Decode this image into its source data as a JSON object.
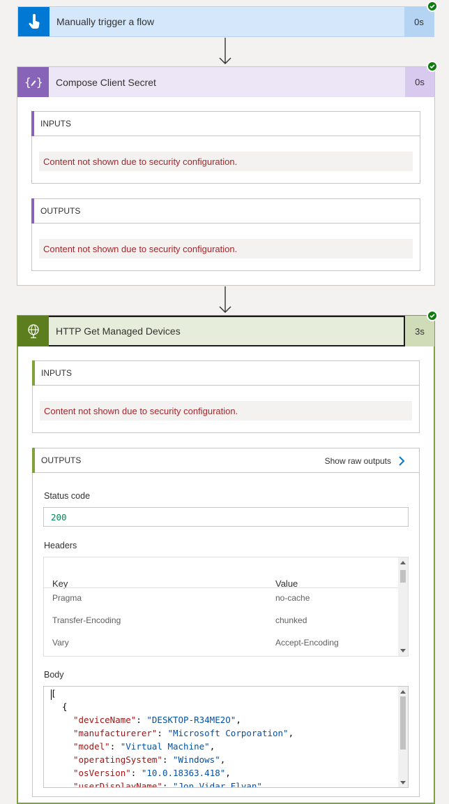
{
  "trigger": {
    "title": "Manually trigger a flow",
    "duration": "0s",
    "icon": "hand-touch-icon"
  },
  "compose": {
    "title": "Compose Client Secret",
    "duration": "0s",
    "icon": "compose-braces-icon",
    "inputs_label": "INPUTS",
    "inputs_msg": "Content not shown due to security configuration.",
    "outputs_label": "OUTPUTS",
    "outputs_msg": "Content not shown due to security configuration."
  },
  "http": {
    "title": "HTTP Get Managed Devices",
    "duration": "3s",
    "icon": "globe-icon",
    "inputs_label": "INPUTS",
    "inputs_msg": "Content not shown due to security configuration.",
    "outputs_label": "OUTPUTS",
    "show_raw": "Show raw outputs",
    "status_label": "Status code",
    "status_value": "200",
    "headers_label": "Headers",
    "headers_col_key": "Key",
    "headers_col_value": "Value",
    "headers": [
      {
        "key": "Pragma",
        "value": "no-cache"
      },
      {
        "key": "Transfer-Encoding",
        "value": "chunked"
      },
      {
        "key": "Vary",
        "value": "Accept-Encoding"
      }
    ],
    "body_label": "Body",
    "body": {
      "open_bracket": "[",
      "open_brace": "{",
      "lines": [
        {
          "key": "\"deviceName\"",
          "value": "\"DESKTOP-R34ME2O\""
        },
        {
          "key": "\"manufacturerer\"",
          "value": "\"Microsoft Corporation\""
        },
        {
          "key": "\"model\"",
          "value": "\"Virtual Machine\""
        },
        {
          "key": "\"operatingSystem\"",
          "value": "\"Windows\""
        },
        {
          "key": "\"osVersion\"",
          "value": "\"10.0.18363.418\""
        },
        {
          "key": "\"userDisplayName\"",
          "value": "\"Jon Vidar Elvan\""
        }
      ]
    }
  },
  "colors": {
    "trigger_accent": "#0078d4",
    "trigger_bg": "#d5e8fb",
    "compose_accent": "#8764b8",
    "compose_bg": "#ece6f6",
    "http_accent": "#5c7e1f",
    "http_bg": "#e6eedb",
    "success": "#107c10",
    "error_text": "#a4262c"
  }
}
